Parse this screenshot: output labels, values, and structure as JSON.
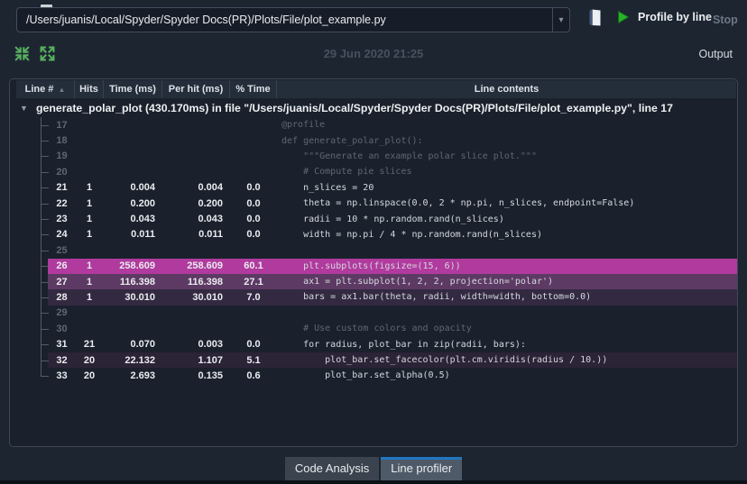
{
  "toolbar": {
    "path_value": "/Users/juanis/Local/Spyder/Spyder Docs(PR)/Plots/File/plot_example.py",
    "profile_button_label": "Profile by line",
    "stop_button_label": "Stop"
  },
  "secondary_bar": {
    "timestamp": "29 Jun 2020 21:25",
    "output_label": "Output"
  },
  "icons": {
    "dropdown_arrow": "▾",
    "sort_ascending": "▲",
    "group_collapse": "▼"
  },
  "colors": {
    "accent_blue": "#1f78c1",
    "icon_green": "#58b05e",
    "play_green": "#27b127",
    "highlight_hot": "#b13a9e",
    "highlight_warm": "#5d3a63",
    "highlight_mild": "#332a42",
    "highlight_faint": "#2b2336"
  },
  "table": {
    "headers": [
      "Line #",
      "Hits",
      "Time (ms)",
      "Per hit (ms)",
      "% Time",
      "Line contents"
    ],
    "group_row": "generate_polar_plot (430.170ms) in file \"/Users/juanis/Local/Spyder/Spyder Docs(PR)/Plots/File/plot_example.py\", line 17",
    "rows": [
      {
        "line": "17",
        "hits": "",
        "time": "",
        "per_hit": "",
        "pct": "",
        "code": "@profile",
        "executed": false,
        "hl": ""
      },
      {
        "line": "18",
        "hits": "",
        "time": "",
        "per_hit": "",
        "pct": "",
        "code": "def generate_polar_plot():",
        "executed": false,
        "hl": ""
      },
      {
        "line": "19",
        "hits": "",
        "time": "",
        "per_hit": "",
        "pct": "",
        "code": "    \"\"\"Generate an example polar slice plot.\"\"\"",
        "executed": false,
        "hl": ""
      },
      {
        "line": "20",
        "hits": "",
        "time": "",
        "per_hit": "",
        "pct": "",
        "code": "    # Compute pie slices",
        "executed": false,
        "hl": ""
      },
      {
        "line": "21",
        "hits": "1",
        "time": "0.004",
        "per_hit": "0.004",
        "pct": "0.0",
        "code": "    n_slices = 20",
        "executed": true,
        "hl": ""
      },
      {
        "line": "22",
        "hits": "1",
        "time": "0.200",
        "per_hit": "0.200",
        "pct": "0.0",
        "code": "    theta = np.linspace(0.0, 2 * np.pi, n_slices, endpoint=False)",
        "executed": true,
        "hl": ""
      },
      {
        "line": "23",
        "hits": "1",
        "time": "0.043",
        "per_hit": "0.043",
        "pct": "0.0",
        "code": "    radii = 10 * np.random.rand(n_slices)",
        "executed": true,
        "hl": ""
      },
      {
        "line": "24",
        "hits": "1",
        "time": "0.011",
        "per_hit": "0.011",
        "pct": "0.0",
        "code": "    width = np.pi / 4 * np.random.rand(n_slices)",
        "executed": true,
        "hl": ""
      },
      {
        "line": "25",
        "hits": "",
        "time": "",
        "per_hit": "",
        "pct": "",
        "code": "",
        "executed": false,
        "hl": ""
      },
      {
        "line": "26",
        "hits": "1",
        "time": "258.609",
        "per_hit": "258.609",
        "pct": "60.1",
        "code": "    plt.subplots(figsize=(15, 6))",
        "executed": true,
        "hl": "#b13a9e"
      },
      {
        "line": "27",
        "hits": "1",
        "time": "116.398",
        "per_hit": "116.398",
        "pct": "27.1",
        "code": "    ax1 = plt.subplot(1, 2, 2, projection='polar')",
        "executed": true,
        "hl": "#5d3a63"
      },
      {
        "line": "28",
        "hits": "1",
        "time": "30.010",
        "per_hit": "30.010",
        "pct": "7.0",
        "code": "    bars = ax1.bar(theta, radii, width=width, bottom=0.0)",
        "executed": true,
        "hl": "#332a42"
      },
      {
        "line": "29",
        "hits": "",
        "time": "",
        "per_hit": "",
        "pct": "",
        "code": "",
        "executed": false,
        "hl": ""
      },
      {
        "line": "30",
        "hits": "",
        "time": "",
        "per_hit": "",
        "pct": "",
        "code": "    # Use custom colors and opacity",
        "executed": false,
        "hl": ""
      },
      {
        "line": "31",
        "hits": "21",
        "time": "0.070",
        "per_hit": "0.003",
        "pct": "0.0",
        "code": "    for radius, plot_bar in zip(radii, bars):",
        "executed": true,
        "hl": ""
      },
      {
        "line": "32",
        "hits": "20",
        "time": "22.132",
        "per_hit": "1.107",
        "pct": "5.1",
        "code": "        plot_bar.set_facecolor(plt.cm.viridis(radius / 10.))",
        "executed": true,
        "hl": "#2b2336"
      },
      {
        "line": "33",
        "hits": "20",
        "time": "2.693",
        "per_hit": "0.135",
        "pct": "0.6",
        "code": "        plot_bar.set_alpha(0.5)",
        "executed": true,
        "hl": ""
      }
    ]
  },
  "tabs": [
    {
      "label": "Code Analysis",
      "active": false
    },
    {
      "label": "Line profiler",
      "active": true
    }
  ]
}
